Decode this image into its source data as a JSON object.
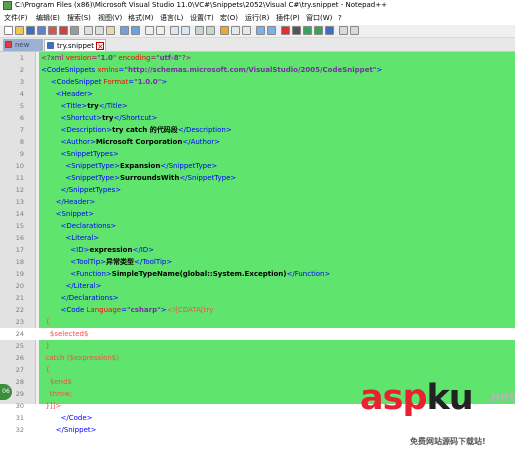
{
  "window": {
    "title": "C:\\Program Files (x86)\\Microsoft Visual Studio 11.0\\VC#\\Snippets\\2052\\Visual C#\\try.snippet - Notepad++"
  },
  "menu": [
    "文件(F)",
    "编辑(E)",
    "搜索(S)",
    "视图(V)",
    "格式(M)",
    "语言(L)",
    "设置(T)",
    "宏(O)",
    "运行(R)",
    "插件(P)",
    "窗口(W)",
    "?"
  ],
  "tabs": [
    {
      "label": "new"
    },
    {
      "label": "try.snippet"
    }
  ],
  "editor": {
    "highlight_color": "#5fe46d",
    "current_line": 24,
    "lines": [
      {
        "n": "1",
        "parts": [
          [
            "pi",
            "<?xml "
          ],
          [
            "attr",
            "version"
          ],
          [
            "pi",
            "=\""
          ],
          [
            "val",
            "1.0"
          ],
          [
            "pi",
            "\" "
          ],
          [
            "attr",
            "encoding"
          ],
          [
            "pi",
            "=\""
          ],
          [
            "val",
            "utf-8"
          ],
          [
            "pi",
            "\"?>"
          ]
        ]
      },
      {
        "n": "2",
        "parts": [
          [
            "bracket",
            "<"
          ],
          [
            "name",
            "CodeSnippets "
          ],
          [
            "attr",
            "xmlns"
          ],
          [
            "bracket",
            "="
          ],
          [
            "val",
            "\"http://schemas.microsoft.com/VisualStudio/2005/CodeSnippet\""
          ],
          [
            "bracket",
            ">"
          ]
        ]
      },
      {
        "n": "3",
        "parts": [
          [
            "text",
            "    "
          ],
          [
            "bracket",
            "<"
          ],
          [
            "name",
            "CodeSnippet "
          ],
          [
            "attr",
            "Format"
          ],
          [
            "bracket",
            "="
          ],
          [
            "val",
            "\"1.0.0\""
          ],
          [
            "bracket",
            ">"
          ]
        ]
      },
      {
        "n": "4",
        "parts": [
          [
            "text",
            "      "
          ],
          [
            "bracket",
            "<"
          ],
          [
            "name",
            "Header"
          ],
          [
            "bracket",
            ">"
          ]
        ]
      },
      {
        "n": "5",
        "parts": [
          [
            "text",
            "        "
          ],
          [
            "bracket",
            "<"
          ],
          [
            "name",
            "Title"
          ],
          [
            "bracket",
            ">"
          ],
          [
            "text",
            "try"
          ],
          [
            "bracket",
            "</"
          ],
          [
            "name",
            "Title"
          ],
          [
            "bracket",
            ">"
          ]
        ]
      },
      {
        "n": "6",
        "parts": [
          [
            "text",
            "        "
          ],
          [
            "bracket",
            "<"
          ],
          [
            "name",
            "Shortcut"
          ],
          [
            "bracket",
            ">"
          ],
          [
            "text",
            "try"
          ],
          [
            "bracket",
            "</"
          ],
          [
            "name",
            "Shortcut"
          ],
          [
            "bracket",
            ">"
          ]
        ]
      },
      {
        "n": "7",
        "parts": [
          [
            "text",
            "        "
          ],
          [
            "bracket",
            "<"
          ],
          [
            "name",
            "Description"
          ],
          [
            "bracket",
            ">"
          ],
          [
            "text",
            "try catch 的代码段"
          ],
          [
            "bracket",
            "</"
          ],
          [
            "name",
            "Description"
          ],
          [
            "bracket",
            ">"
          ]
        ]
      },
      {
        "n": "8",
        "parts": [
          [
            "text",
            "        "
          ],
          [
            "bracket",
            "<"
          ],
          [
            "name",
            "Author"
          ],
          [
            "bracket",
            ">"
          ],
          [
            "text",
            "Microsoft Corporation"
          ],
          [
            "bracket",
            "</"
          ],
          [
            "name",
            "Author"
          ],
          [
            "bracket",
            ">"
          ]
        ]
      },
      {
        "n": "9",
        "parts": [
          [
            "text",
            "        "
          ],
          [
            "bracket",
            "<"
          ],
          [
            "name",
            "SnippetTypes"
          ],
          [
            "bracket",
            ">"
          ]
        ]
      },
      {
        "n": "10",
        "parts": [
          [
            "text",
            "          "
          ],
          [
            "bracket",
            "<"
          ],
          [
            "name",
            "SnippetType"
          ],
          [
            "bracket",
            ">"
          ],
          [
            "text",
            "Expansion"
          ],
          [
            "bracket",
            "</"
          ],
          [
            "name",
            "SnippetType"
          ],
          [
            "bracket",
            ">"
          ]
        ]
      },
      {
        "n": "11",
        "parts": [
          [
            "text",
            "          "
          ],
          [
            "bracket",
            "<"
          ],
          [
            "name",
            "SnippetType"
          ],
          [
            "bracket",
            ">"
          ],
          [
            "text",
            "SurroundsWith"
          ],
          [
            "bracket",
            "</"
          ],
          [
            "name",
            "SnippetType"
          ],
          [
            "bracket",
            ">"
          ]
        ]
      },
      {
        "n": "12",
        "parts": [
          [
            "text",
            "        "
          ],
          [
            "bracket",
            "</"
          ],
          [
            "name",
            "SnippetTypes"
          ],
          [
            "bracket",
            ">"
          ]
        ]
      },
      {
        "n": "13",
        "parts": [
          [
            "text",
            "      "
          ],
          [
            "bracket",
            "</"
          ],
          [
            "name",
            "Header"
          ],
          [
            "bracket",
            ">"
          ]
        ]
      },
      {
        "n": "14",
        "parts": [
          [
            "text",
            "      "
          ],
          [
            "bracket",
            "<"
          ],
          [
            "name",
            "Snippet"
          ],
          [
            "bracket",
            ">"
          ]
        ]
      },
      {
        "n": "15",
        "parts": [
          [
            "text",
            "        "
          ],
          [
            "bracket",
            "<"
          ],
          [
            "name",
            "Declarations"
          ],
          [
            "bracket",
            ">"
          ]
        ]
      },
      {
        "n": "16",
        "parts": [
          [
            "text",
            "          "
          ],
          [
            "bracket",
            "<"
          ],
          [
            "name",
            "Literal"
          ],
          [
            "bracket",
            ">"
          ]
        ]
      },
      {
        "n": "17",
        "parts": [
          [
            "text",
            "            "
          ],
          [
            "bracket",
            "<"
          ],
          [
            "name",
            "ID"
          ],
          [
            "bracket",
            ">"
          ],
          [
            "text",
            "expression"
          ],
          [
            "bracket",
            "</"
          ],
          [
            "name",
            "ID"
          ],
          [
            "bracket",
            ">"
          ]
        ]
      },
      {
        "n": "18",
        "parts": [
          [
            "text",
            "            "
          ],
          [
            "bracket",
            "<"
          ],
          [
            "name",
            "ToolTip"
          ],
          [
            "bracket",
            ">"
          ],
          [
            "text",
            "异常类型"
          ],
          [
            "bracket",
            "</"
          ],
          [
            "name",
            "ToolTip"
          ],
          [
            "bracket",
            ">"
          ]
        ]
      },
      {
        "n": "19",
        "parts": [
          [
            "text",
            "            "
          ],
          [
            "bracket",
            "<"
          ],
          [
            "name",
            "Function"
          ],
          [
            "bracket",
            ">"
          ],
          [
            "text",
            "SimpleTypeName(global::System.Exception)"
          ],
          [
            "bracket",
            "</"
          ],
          [
            "name",
            "Function"
          ],
          [
            "bracket",
            ">"
          ]
        ]
      },
      {
        "n": "20",
        "parts": [
          [
            "text",
            "          "
          ],
          [
            "bracket",
            "</"
          ],
          [
            "name",
            "Literal"
          ],
          [
            "bracket",
            ">"
          ]
        ]
      },
      {
        "n": "21",
        "parts": [
          [
            "text",
            "        "
          ],
          [
            "bracket",
            "</"
          ],
          [
            "name",
            "Declarations"
          ],
          [
            "bracket",
            ">"
          ]
        ]
      },
      {
        "n": "22",
        "parts": [
          [
            "text",
            "        "
          ],
          [
            "bracket",
            "<"
          ],
          [
            "name",
            "Code "
          ],
          [
            "attr",
            "Language"
          ],
          [
            "bracket",
            "="
          ],
          [
            "val",
            "\"csharp\""
          ],
          [
            "bracket",
            ">"
          ],
          [
            "cdata",
            "<![CDATA[try"
          ]
        ]
      },
      {
        "n": "23",
        "parts": [
          [
            "cdata",
            "  {"
          ]
        ]
      },
      {
        "n": "24",
        "parts": [
          [
            "cdata",
            "    $selected$"
          ]
        ]
      },
      {
        "n": "25",
        "parts": [
          [
            "cdata",
            "  }"
          ]
        ]
      },
      {
        "n": "26",
        "parts": [
          [
            "cdata",
            "  catch ($expression$)"
          ]
        ]
      },
      {
        "n": "27",
        "parts": [
          [
            "cdata",
            "  {"
          ]
        ]
      },
      {
        "n": "28",
        "parts": [
          [
            "cdata",
            "    $end$"
          ]
        ]
      },
      {
        "n": "29",
        "parts": [
          [
            "cdata",
            "    throw;"
          ]
        ]
      },
      {
        "n": "30",
        "parts": [
          [
            "cdata",
            "  }]]>"
          ]
        ]
      },
      {
        "n": "31",
        "parts": [
          [
            "text",
            "        "
          ],
          [
            "bracket",
            "</"
          ],
          [
            "name",
            "Code"
          ],
          [
            "bracket",
            ">"
          ]
        ]
      },
      {
        "n": "32",
        "parts": [
          [
            "text",
            "      "
          ],
          [
            "bracket",
            "</"
          ],
          [
            "name",
            "Snippet"
          ],
          [
            "bracket",
            ">"
          ]
        ]
      }
    ]
  },
  "watermark": {
    "brand_red": "asp",
    "brand_dark": "ku",
    "brand_suffix": ".net",
    "tagline": "免费网站源码下载站!"
  },
  "side_badge": "06"
}
